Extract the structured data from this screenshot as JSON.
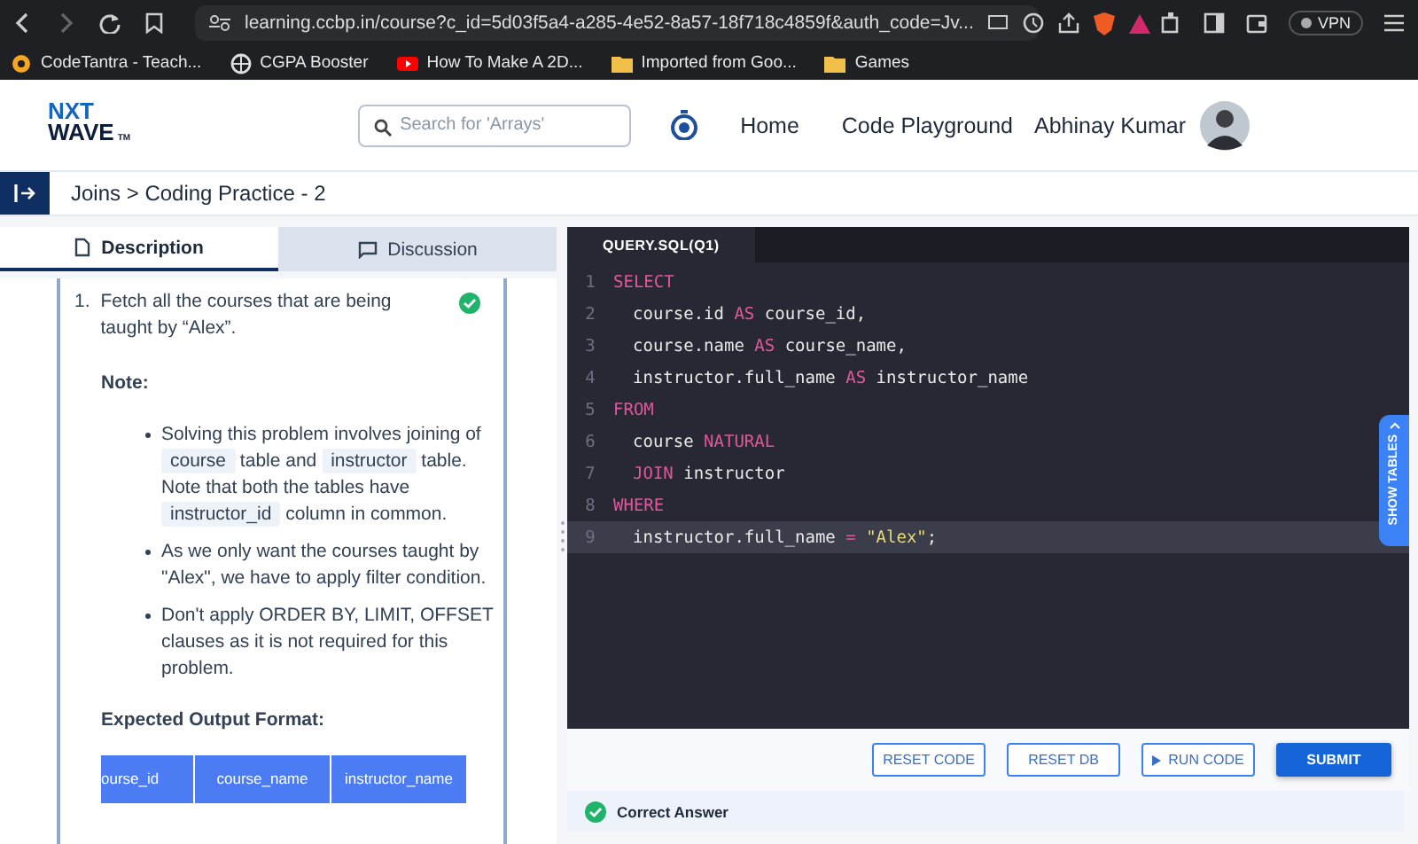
{
  "browser": {
    "url": "learning.ccbp.in/course?c_id=5d03f5a4-a285-4e52-8a57-18f718c4859f&auth_code=Jv...",
    "vpn": "VPN",
    "bookmarks": [
      {
        "label": "CodeTantra - Teach...",
        "kind": "star"
      },
      {
        "label": "CGPA Booster",
        "kind": "globe"
      },
      {
        "label": "How To Make A 2D...",
        "kind": "video"
      },
      {
        "label": "Imported from Goo...",
        "kind": "folder"
      },
      {
        "label": "Games",
        "kind": "folder"
      }
    ]
  },
  "header": {
    "logo_top": "NXT",
    "logo_bottom": "WAVE",
    "logo_mark": "TM",
    "search": {
      "placeholder": "Search for 'Arrays'"
    },
    "nav": [
      "Home",
      "Code Playground"
    ],
    "user": "Abhinay Kumar"
  },
  "breadcrumb": "Joins > Coding Practice - 2",
  "tabs": [
    {
      "label": "Description",
      "selected": true
    },
    {
      "label": "Discussion",
      "selected": false
    }
  ],
  "question": {
    "number": "1.",
    "text": "Fetch all the courses that are being taught by “Alex”.",
    "solved": true,
    "note_title": "Note:",
    "bullets": [
      [
        {
          "kind": "text",
          "text": "Solving this problem involves joining of "
        },
        {
          "kind": "code",
          "text": "course"
        },
        {
          "kind": "text",
          "text": " table and "
        },
        {
          "kind": "code",
          "text": "instructor"
        },
        {
          "kind": "text",
          "text": " table. Note that both the tables have "
        },
        {
          "kind": "code",
          "text": "instructor_id"
        },
        {
          "kind": "text",
          "text": " column in common."
        }
      ],
      [
        {
          "kind": "text",
          "text": "As we only want the courses taught by \"Alex\", we have to apply filter condition."
        }
      ],
      [
        {
          "kind": "text",
          "text": "Don't apply ORDER BY, LIMIT, OFFSET clauses as it is not required for this problem."
        }
      ]
    ],
    "output_title": "Expected Output Format:",
    "output_columns": [
      "ourse_id",
      "course_name",
      "instructor_name"
    ]
  },
  "editor": {
    "file_tab": "QUERY.SQL(Q1)",
    "side_tab": "SHOW TABLES",
    "lines": [
      {
        "number": "1",
        "indented": false,
        "active": false,
        "tokens": [
          {
            "kind": "keyword",
            "text": "SELECT"
          }
        ]
      },
      {
        "number": "2",
        "indented": true,
        "active": false,
        "tokens": [
          {
            "kind": "plain",
            "text": "course.id "
          },
          {
            "kind": "keyword",
            "text": "AS"
          },
          {
            "kind": "plain",
            "text": " course_id,"
          }
        ]
      },
      {
        "number": "3",
        "indented": true,
        "active": false,
        "tokens": [
          {
            "kind": "plain",
            "text": "course.name "
          },
          {
            "kind": "keyword",
            "text": "AS"
          },
          {
            "kind": "plain",
            "text": " course_name,"
          }
        ]
      },
      {
        "number": "4",
        "indented": true,
        "active": false,
        "tokens": [
          {
            "kind": "plain",
            "text": "instructor.full_name "
          },
          {
            "kind": "keyword",
            "text": "AS"
          },
          {
            "kind": "plain",
            "text": " instructor_name"
          }
        ]
      },
      {
        "number": "5",
        "indented": false,
        "active": false,
        "tokens": [
          {
            "kind": "keyword",
            "text": "FROM"
          }
        ]
      },
      {
        "number": "6",
        "indented": true,
        "active": false,
        "tokens": [
          {
            "kind": "plain",
            "text": "course "
          },
          {
            "kind": "keyword",
            "text": "NATURAL"
          }
        ]
      },
      {
        "number": "7",
        "indented": true,
        "active": false,
        "tokens": [
          {
            "kind": "keyword",
            "text": "JOIN"
          },
          {
            "kind": "plain",
            "text": " instructor"
          }
        ]
      },
      {
        "number": "8",
        "indented": false,
        "active": false,
        "tokens": [
          {
            "kind": "keyword",
            "text": "WHERE"
          }
        ]
      },
      {
        "number": "9",
        "indented": true,
        "active": true,
        "tokens": [
          {
            "kind": "plain",
            "text": "instructor.full_name "
          },
          {
            "kind": "keyword",
            "text": "="
          },
          {
            "kind": "string",
            "text": " \"Alex\""
          },
          {
            "kind": "plain",
            "text": ";"
          }
        ]
      }
    ]
  },
  "actions": [
    {
      "label": "RESET CODE",
      "kind": "outline"
    },
    {
      "label": "RESET DB",
      "kind": "outline"
    },
    {
      "label": "RUN CODE",
      "kind": "run"
    },
    {
      "label": "SUBMIT",
      "kind": "primary"
    }
  ],
  "result": {
    "status": "Correct Answer",
    "correct": true
  }
}
